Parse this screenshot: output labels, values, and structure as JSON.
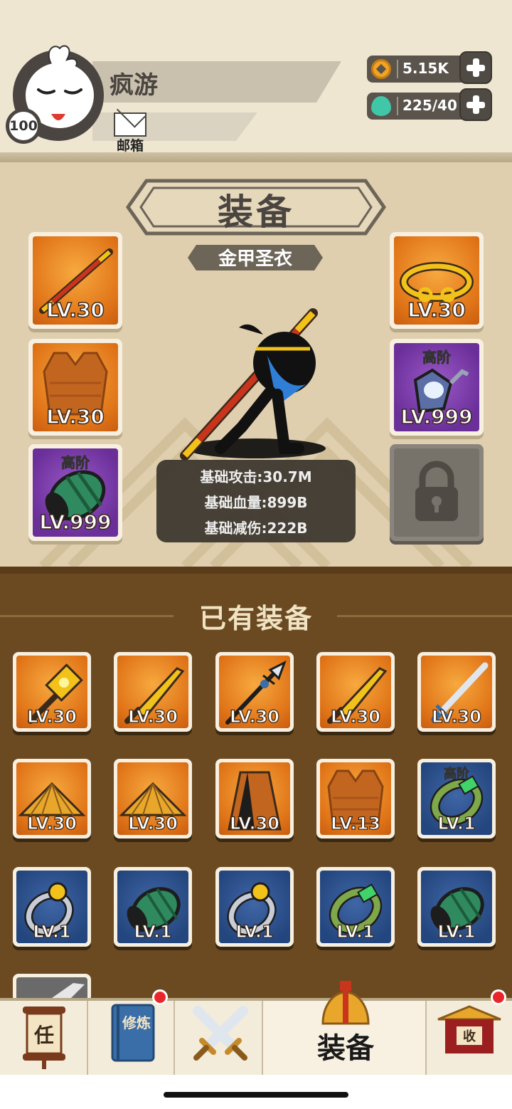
{
  "player": {
    "name": "疯游",
    "level": "100",
    "mail_label": "邮箱"
  },
  "resources": {
    "gold": "5.15K",
    "gems": "225/40"
  },
  "equip": {
    "title": "装备",
    "suit_name": "金甲圣衣",
    "slots": [
      {
        "item": "golden staff",
        "level": "LV.30",
        "tier": ""
      },
      {
        "item": "armor vest",
        "level": "LV.30",
        "tier": ""
      },
      {
        "item": "jade bracer",
        "level": "LV.999",
        "tier": "高阶"
      },
      {
        "item": "golden circlet",
        "level": "LV.30",
        "tier": ""
      },
      {
        "item": "crystal amulet",
        "level": "LV.999",
        "tier": "高阶"
      },
      {
        "item": "locked slot",
        "level": "",
        "tier": ""
      }
    ],
    "stats": [
      "基础攻击:30.7M",
      "基础血量:899B",
      "基础减伤:222B"
    ]
  },
  "inventory": {
    "title": "已有装备",
    "items": [
      {
        "item": "golden hammer",
        "level": "LV.30",
        "tier": "",
        "bg": "orange"
      },
      {
        "item": "golden broadsword",
        "level": "LV.30",
        "tier": "",
        "bg": "orange"
      },
      {
        "item": "halberd",
        "level": "LV.30",
        "tier": "",
        "bg": "orange"
      },
      {
        "item": "golden broadsword",
        "level": "LV.30",
        "tier": "",
        "bg": "orange"
      },
      {
        "item": "steel sword",
        "level": "LV.30",
        "tier": "",
        "bg": "orange"
      },
      {
        "item": "straw hat",
        "level": "LV.30",
        "tier": "",
        "bg": "orange"
      },
      {
        "item": "straw hat",
        "level": "LV.30",
        "tier": "",
        "bg": "orange"
      },
      {
        "item": "cloak",
        "level": "LV.30",
        "tier": "",
        "bg": "orange"
      },
      {
        "item": "armor vest",
        "level": "LV.13",
        "tier": "",
        "bg": "orange"
      },
      {
        "item": "jade ring",
        "level": "LV.1",
        "tier": "高阶",
        "bg": "blue"
      },
      {
        "item": "pearl ring",
        "level": "LV.1",
        "tier": "",
        "bg": "blue"
      },
      {
        "item": "jade bracer",
        "level": "LV.1",
        "tier": "",
        "bg": "blue"
      },
      {
        "item": "pearl ring",
        "level": "LV.1",
        "tier": "",
        "bg": "blue"
      },
      {
        "item": "jade ring",
        "level": "LV.1",
        "tier": "",
        "bg": "blue"
      },
      {
        "item": "jade bracer",
        "level": "LV.1",
        "tier": "",
        "bg": "blue"
      }
    ]
  },
  "nav": {
    "tabs": [
      {
        "icon": "scroll-icon",
        "glyph": "任"
      },
      {
        "icon": "book-icon",
        "glyph": "修炼"
      },
      {
        "icon": "crossed-swords-icon",
        "glyph": ""
      },
      {
        "icon": "helmet-icon",
        "label": "装备"
      },
      {
        "icon": "shop-icon",
        "glyph": "收"
      }
    ]
  },
  "colors": {
    "panel": "#dfcfae",
    "inventory": "#6b4a22",
    "orange_bg": "#e07418",
    "purple_bg": "#6b2f9a",
    "blue_bg": "#24467e",
    "badge_red": "#e8262a"
  }
}
